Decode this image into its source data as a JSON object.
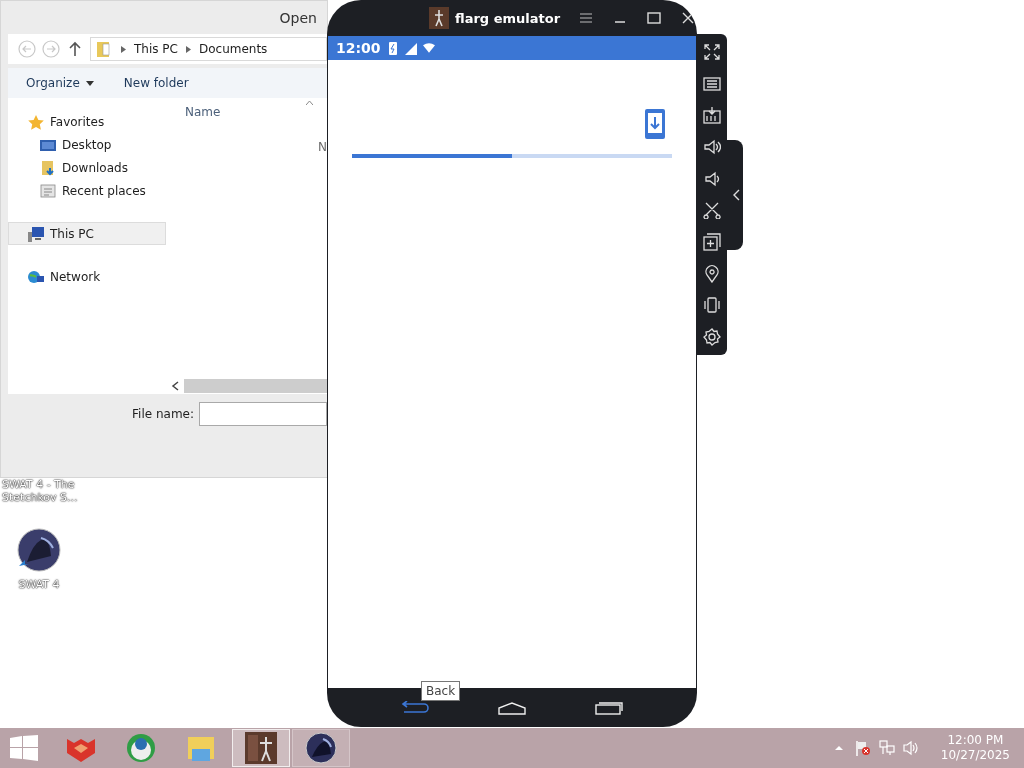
{
  "file_dialog": {
    "title": "Open",
    "breadcrumb": [
      "This PC",
      "Documents"
    ],
    "toolbar": [
      {
        "label": "Organize",
        "kind": "menu"
      },
      {
        "label": "New folder",
        "kind": "plain"
      }
    ],
    "column_header": "Name",
    "empty_text": "N",
    "nav_items": [
      {
        "label": "Favorites",
        "kind": "star",
        "selected": false,
        "children": [
          {
            "label": "Desktop",
            "kind": "desktop",
            "selected": false
          },
          {
            "label": "Downloads",
            "kind": "downloads",
            "selected": false
          },
          {
            "label": "Recent places",
            "kind": "recent",
            "selected": false
          }
        ]
      },
      {
        "label": "This PC",
        "kind": "pc",
        "selected": true
      },
      {
        "label": "Network",
        "kind": "network",
        "selected": false
      }
    ],
    "file_name_label": "File name:"
  },
  "emulator": {
    "title": "flarg emulator",
    "status_time": "12:00",
    "progress": {
      "level": 0.5
    },
    "tooltip": "Back"
  },
  "desktop_icons": [
    {
      "label": "SWAT 4 - The Stetchkov S...",
      "kind": "label-only"
    },
    {
      "label": "SWAT 4",
      "kind": "game"
    }
  ],
  "taskbar": {
    "apps": [
      {
        "kind": "fox",
        "selected": false,
        "running": false
      },
      {
        "kind": "globe",
        "selected": false,
        "running": false
      },
      {
        "kind": "folder",
        "selected": false,
        "running": false
      },
      {
        "kind": "emulator",
        "selected": true,
        "running": true
      },
      {
        "kind": "game",
        "selected": false,
        "running": true
      }
    ],
    "clock": {
      "time": "12:00 PM",
      "date": "10/27/2025"
    }
  }
}
